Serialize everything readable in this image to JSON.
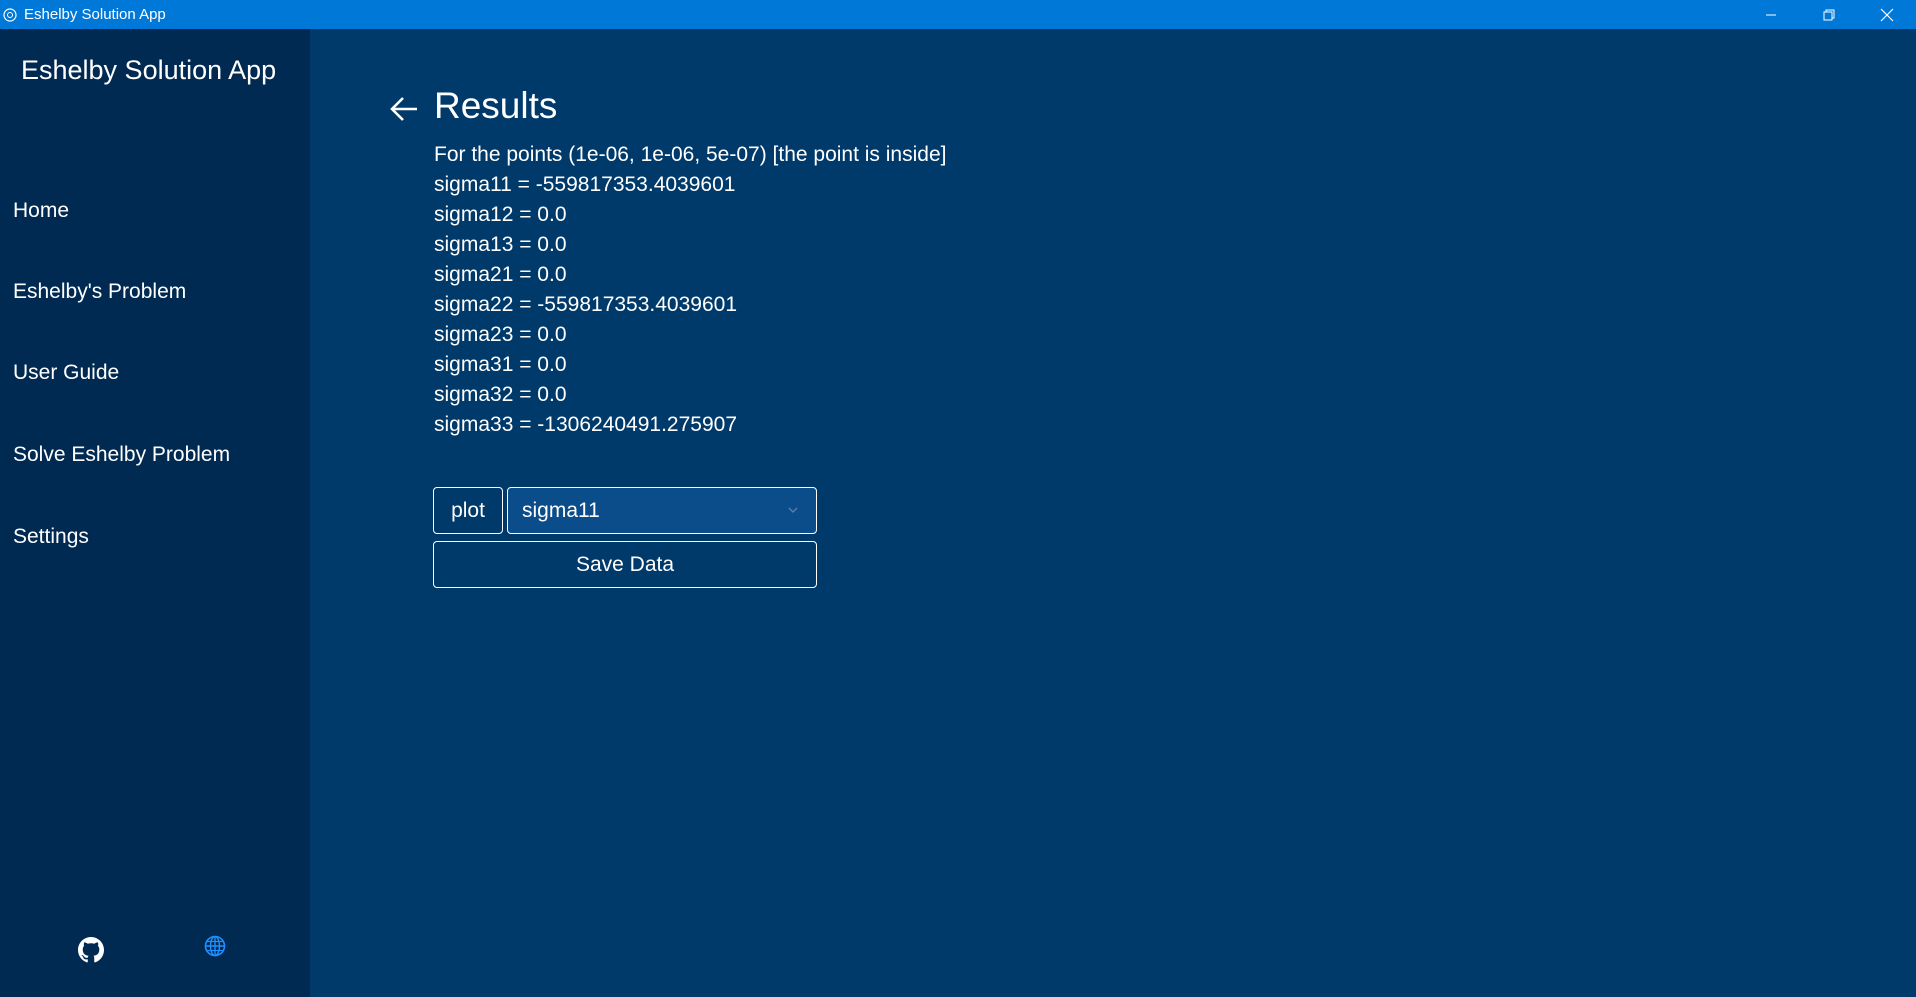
{
  "window": {
    "title": "Eshelby Solution App",
    "controls": [
      "minimize-icon",
      "restore-icon",
      "close-icon"
    ]
  },
  "sidebar": {
    "app_title": "Eshelby Solution App",
    "items": [
      {
        "label": "Home"
      },
      {
        "label": "Eshelby's Problem"
      },
      {
        "label": "User Guide"
      },
      {
        "label": "Solve Eshelby Problem"
      },
      {
        "label": "Settings"
      }
    ],
    "footer_icons": [
      "github-icon",
      "globe-icon"
    ]
  },
  "main": {
    "title": "Results",
    "back_icon": "arrow-left-icon",
    "lines": [
      "For the points (1e-06, 1e-06, 5e-07) [the point is inside]",
      "sigma11 = -559817353.4039601",
      "sigma12 = 0.0",
      "sigma13 = 0.0",
      "sigma21 = 0.0",
      "sigma22 = -559817353.4039601",
      "sigma23 = 0.0",
      "sigma31 = 0.0",
      "sigma32 = 0.0",
      "sigma33 = -1306240491.275907"
    ],
    "plot_label": "plot",
    "select_value": "sigma11",
    "save_label": "Save Data"
  },
  "colors": {
    "titlebar": "#0078d7",
    "sidebar": "#002a52",
    "main": "#003a6b",
    "select": "#0a4d8a",
    "globe": "#1e90ff"
  }
}
